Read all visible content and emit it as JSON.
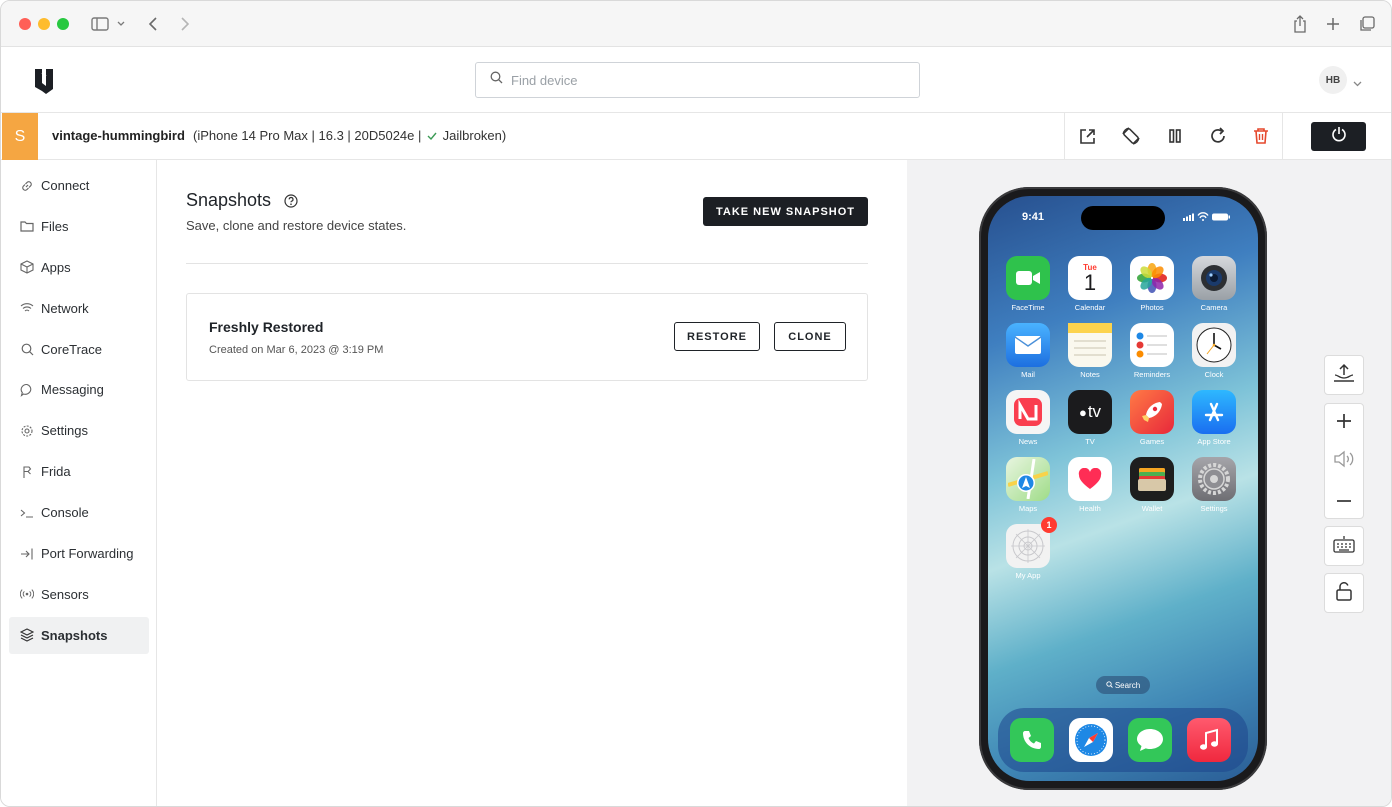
{
  "search": {
    "placeholder": "Find device"
  },
  "user": {
    "initials": "HB"
  },
  "device": {
    "badge": "S",
    "name": "vintage-hummingbird",
    "info_prefix": "(iPhone 14 Pro Max | 16.3 | 20D5024e |",
    "jailbroken": "Jailbroken)",
    "accent_color": "#f5a642"
  },
  "sidebar": {
    "items": [
      {
        "label": "Connect",
        "icon": "link-icon"
      },
      {
        "label": "Files",
        "icon": "folder-icon"
      },
      {
        "label": "Apps",
        "icon": "cube-icon"
      },
      {
        "label": "Network",
        "icon": "wifi-icon"
      },
      {
        "label": "CoreTrace",
        "icon": "search-icon"
      },
      {
        "label": "Messaging",
        "icon": "chat-icon"
      },
      {
        "label": "Settings",
        "icon": "gear-icon"
      },
      {
        "label": "Frida",
        "icon": "frida-icon"
      },
      {
        "label": "Console",
        "icon": "terminal-icon"
      },
      {
        "label": "Port Forwarding",
        "icon": "port-forward-icon"
      },
      {
        "label": "Sensors",
        "icon": "sensor-icon"
      },
      {
        "label": "Snapshots",
        "icon": "layers-icon",
        "active": true
      }
    ]
  },
  "main": {
    "title": "Snapshots",
    "subtitle": "Save, clone and restore device states.",
    "take_snapshot_label": "TAKE NEW SNAPSHOT",
    "snapshots": [
      {
        "name": "Freshly Restored",
        "created": "Created on Mar 6, 2023 @ 3:19 PM",
        "restore_label": "RESTORE",
        "clone_label": "CLONE"
      }
    ]
  },
  "phone": {
    "time": "9:41",
    "apps": [
      {
        "label": "FaceTime",
        "icon": "facetime-icon",
        "color": "#2fc24c"
      },
      {
        "label": "Calendar",
        "icon": "calendar-icon",
        "color": "#ffffff",
        "day": "Tue",
        "date": "1"
      },
      {
        "label": "Photos",
        "icon": "photos-icon",
        "color": "#ffffff"
      },
      {
        "label": "Camera",
        "icon": "camera-icon",
        "color": "#b7bcc2"
      },
      {
        "label": "Mail",
        "icon": "mail-icon",
        "color": "#2d8cf0"
      },
      {
        "label": "Notes",
        "icon": "notes-icon",
        "color": "#f7f2dc"
      },
      {
        "label": "Reminders",
        "icon": "reminders-icon",
        "color": "#ffffff"
      },
      {
        "label": "Clock",
        "icon": "clock-icon",
        "color": "#f5f5f5"
      },
      {
        "label": "News",
        "icon": "news-icon",
        "color": "#f5f5f5"
      },
      {
        "label": "TV",
        "icon": "tv-icon",
        "color": "#1b1b1d",
        "text": "tv"
      },
      {
        "label": "Games",
        "icon": "games-icon",
        "color": "#f0453c"
      },
      {
        "label": "App Store",
        "icon": "app-store-icon",
        "color": "#1c8cf3"
      },
      {
        "label": "Maps",
        "icon": "maps-icon",
        "color": "#7fd37a"
      },
      {
        "label": "Health",
        "icon": "health-icon",
        "color": "#ffffff"
      },
      {
        "label": "Wallet",
        "icon": "wallet-icon",
        "color": "#1e1e1e"
      },
      {
        "label": "Settings",
        "icon": "settings-icon",
        "color": "#8e8e93"
      },
      {
        "label": "My App",
        "icon": "my-app-icon",
        "color": "#f2f2f2",
        "badge": "1"
      }
    ],
    "search_label": "Search",
    "dock": [
      {
        "icon": "phone-icon",
        "color": "#33c759"
      },
      {
        "icon": "safari-icon",
        "color": "#ffffff"
      },
      {
        "icon": "messages-icon",
        "color": "#33c759"
      },
      {
        "icon": "music-icon",
        "color": "#fc3c55"
      }
    ]
  }
}
